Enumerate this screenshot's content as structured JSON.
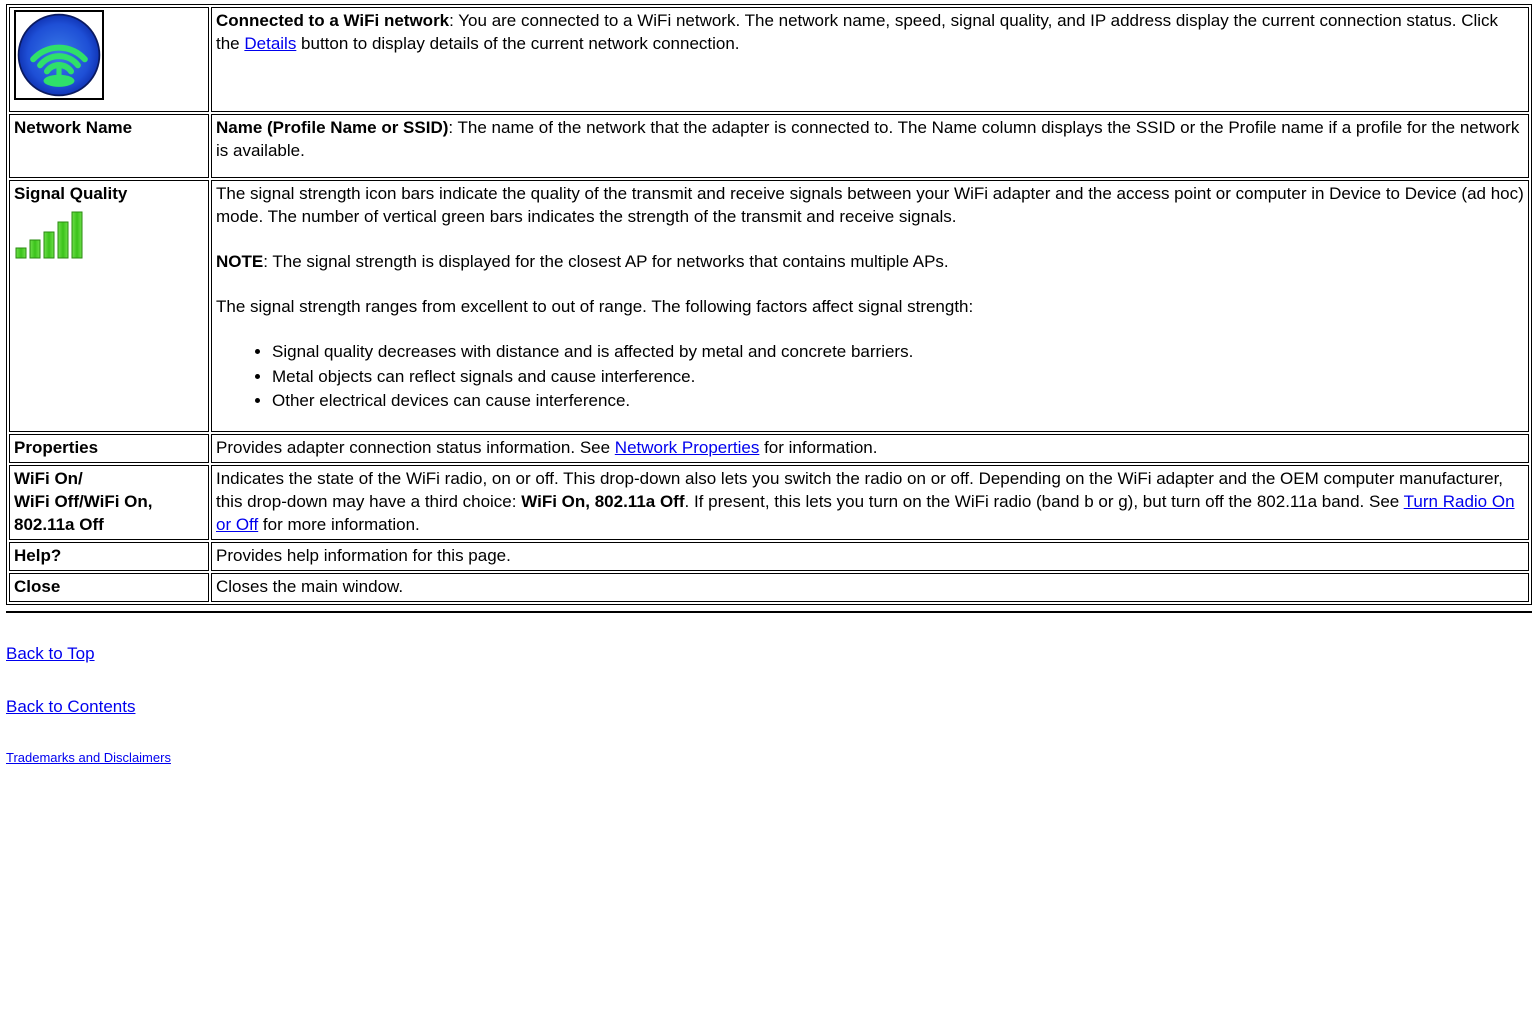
{
  "rows": {
    "connected": {
      "title": "Connected to a WiFi network",
      "body_before": ": You are connected to a WiFi network. The network name, speed, signal quality, and IP address display the current connection status. Click the ",
      "link_text": "Details",
      "body_after": " button to display details of the current network connection."
    },
    "network_name": {
      "label": "Network Name",
      "desc_title": "Name (Profile Name or SSID)",
      "desc_body": ": The name of the network that the adapter is connected to. The Name column displays the SSID or the Profile name if a profile for the network is available."
    },
    "signal_quality": {
      "label": "Signal Quality",
      "p1": "The signal strength icon bars indicate the quality of the transmit and receive signals between your WiFi adapter and the access point or computer in Device to Device (ad hoc) mode. The number of vertical green bars indicates the strength of the transmit and receive signals.",
      "note_label": "NOTE",
      "note_body": ": The signal strength is displayed for the closest AP for networks that contains multiple APs.",
      "p3": "The signal strength ranges from excellent to out of range. The following factors affect signal strength:",
      "factors": [
        "Signal quality decreases with distance and is affected by metal and concrete barriers.",
        "Metal objects can reflect signals and cause interference.",
        "Other electrical devices can cause interference."
      ]
    },
    "properties": {
      "label": "Properties",
      "before": "Provides adapter connection status information. See ",
      "link": "Network Properties",
      "after": " for information."
    },
    "wifi_toggle": {
      "label_line1": "WiFi On/",
      "label_line2": "WiFi Off/WiFi On, 802.11a Off",
      "body_before": "Indicates the state of the WiFi radio, on or off. This drop-down also lets you switch the radio on or off. Depending on the WiFi adapter and the OEM computer manufacturer, this drop-down may have a third choice: ",
      "bold_choice": "WiFi On, 802.11a Off",
      "body_mid": ". If present, this lets you turn on the WiFi radio (band b or g), but turn off the 802.11a band. See ",
      "link": "Turn Radio On or Off",
      "body_after": " for more information."
    },
    "help": {
      "label": "Help?",
      "body": "Provides help information for this page."
    },
    "close": {
      "label": "Close",
      "body": "Closes the main window."
    }
  },
  "nav": {
    "back_top": "Back to Top",
    "back_contents": "Back to Contents",
    "trademarks": "Trademarks and Disclaimers"
  }
}
